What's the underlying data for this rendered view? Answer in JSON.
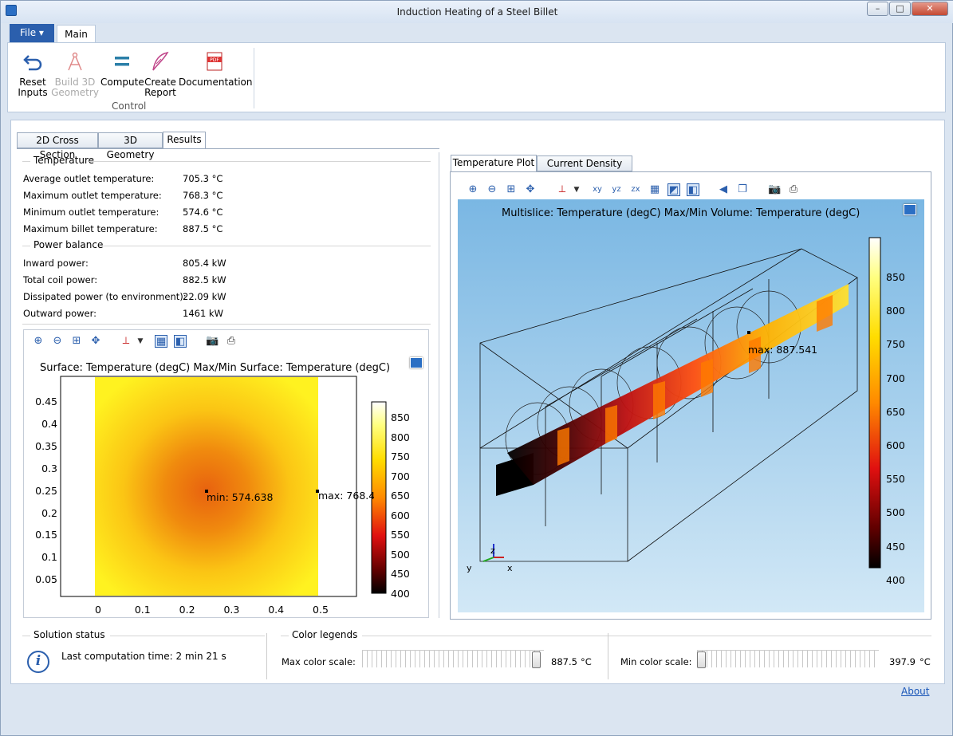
{
  "window": {
    "title": "Induction Heating of a Steel Billet"
  },
  "ribbon": {
    "file_tab": "File ▾",
    "main_tab": "Main",
    "buttons": [
      {
        "line1": "Reset",
        "line2": "Inputs"
      },
      {
        "line1": "Build 3D",
        "line2": "Geometry"
      },
      {
        "line1": "Compute",
        "line2": ""
      },
      {
        "line1": "Create",
        "line2": "Report"
      },
      {
        "line1": "Documentation",
        "line2": ""
      }
    ],
    "group_label": "Control"
  },
  "tabs": [
    "2D Cross Section",
    "3D Geometry",
    "Results"
  ],
  "temperature": {
    "heading": "Temperature",
    "rows": [
      {
        "label": "Average outlet temperature:",
        "value": "705.3 °C"
      },
      {
        "label": "Maximum outlet temperature:",
        "value": "768.3 °C"
      },
      {
        "label": "Minimum outlet temperature:",
        "value": "574.6 °C"
      },
      {
        "label": "Maximum billet temperature:",
        "value": "887.5 °C"
      }
    ]
  },
  "power": {
    "heading": "Power balance",
    "rows": [
      {
        "label": "Inward power:",
        "value": "805.4 kW"
      },
      {
        "label": "Total coil power:",
        "value": "882.5 kW"
      },
      {
        "label": "Dissipated power (to environment):",
        "value": "22.09 kW"
      },
      {
        "label": "Outward power:",
        "value": "1461 kW"
      }
    ]
  },
  "plot2d": {
    "title": "Surface: Temperature (degC)  Max/Min Surface: Temperature (degC)",
    "y_ticks": [
      "0.45",
      "0.4",
      "0.35",
      "0.3",
      "0.25",
      "0.2",
      "0.15",
      "0.1",
      "0.05"
    ],
    "x_ticks": [
      "0",
      "0.1",
      "0.2",
      "0.3",
      "0.4",
      "0.5"
    ],
    "colorbar_ticks": [
      "850",
      "800",
      "750",
      "700",
      "650",
      "600",
      "550",
      "500",
      "450",
      "400"
    ],
    "min_label": "min: 574.638",
    "max_label": "max: 768.4"
  },
  "plot3d": {
    "tabs": [
      "Temperature Plot",
      "Current Density Plot"
    ],
    "title": "Multislice: Temperature (degC)  Max/Min Volume: Temperature (degC)",
    "colorbar_ticks": [
      "850",
      "800",
      "750",
      "700",
      "650",
      "600",
      "550",
      "500",
      "450",
      "400"
    ],
    "max_label": "max: 887.541",
    "axes": {
      "z": "z",
      "y": "y",
      "x": "x"
    }
  },
  "status": {
    "heading": "Solution status",
    "text": "Last computation time: 2 min 21 s"
  },
  "legends": {
    "heading": "Color legends",
    "max_label": "Max color scale:",
    "max_value": "887.5",
    "min_label": "Min color scale:",
    "min_value": "397.9",
    "unit": "°C",
    "max_slider_level": 0.98,
    "min_slider_level": 0.0
  },
  "about_link": "About",
  "colors": {
    "accent": "#2b5fad",
    "sky_top": "#7ab7e3",
    "sky_bottom": "#d2e8f6"
  }
}
